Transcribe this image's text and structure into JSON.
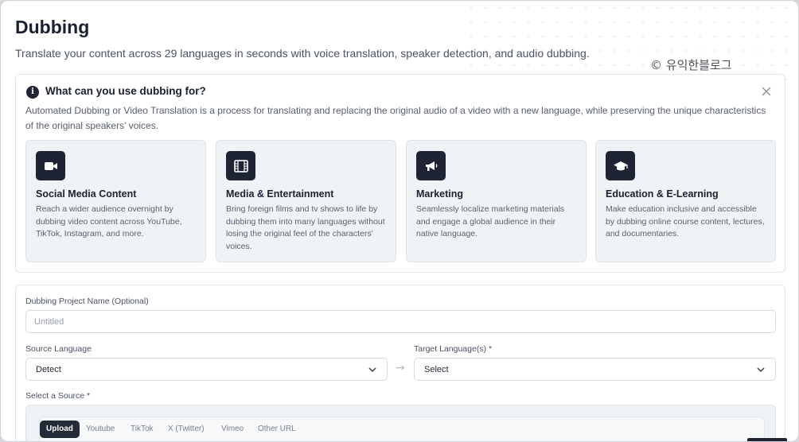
{
  "page": {
    "title": "Dubbing",
    "subtitle": "Translate your content across 29 languages in seconds with voice translation, speaker detection, and audio dubbing.",
    "watermark": "© 유익한블로그"
  },
  "info": {
    "heading": "What can you use dubbing for?",
    "description": "Automated Dubbing or Video Translation is a process for translating and replacing the original audio of a video with a new language, while preserving the unique characteristics of the original speakers' voices.",
    "icon": "info-icon",
    "close_icon": "close-icon",
    "cards": [
      {
        "icon": "video-camera-icon",
        "title": "Social Media Content",
        "description": "Reach a wider audience overnight by dubbing video content across YouTube, TikTok, Instagram, and more."
      },
      {
        "icon": "film-icon",
        "title": "Media & Entertainment",
        "description": "Bring foreign films and tv shows to life by dubbing them into many languages without losing the original feel of the characters' voices."
      },
      {
        "icon": "megaphone-icon",
        "title": "Marketing",
        "description": "Seamlessly localize marketing materials and engage a global audience in their native language."
      },
      {
        "icon": "graduation-cap-icon",
        "title": "Education & E-Learning",
        "description": "Make education inclusive and accessible by dubbing online course content, lectures, and documentaries."
      }
    ]
  },
  "form": {
    "project_name_label": "Dubbing Project Name (Optional)",
    "project_name_placeholder": "Untitled",
    "project_name_value": "",
    "source_language_label": "Source Language",
    "source_language_value": "Detect",
    "target_language_label": "Target Language(s) *",
    "target_language_value": "Select",
    "arrow_glyph": "→",
    "source_label": "Select a Source *",
    "source_tabs": [
      "Upload",
      "Youtube",
      "TikTok",
      "X (Twitter)",
      "Vimeo",
      "Other URL"
    ],
    "active_tab": "Upload"
  },
  "colors": {
    "icon_bg": "#1e2433",
    "card_bg": "#f0f3f6",
    "active_tab_bg": "#232a38"
  }
}
